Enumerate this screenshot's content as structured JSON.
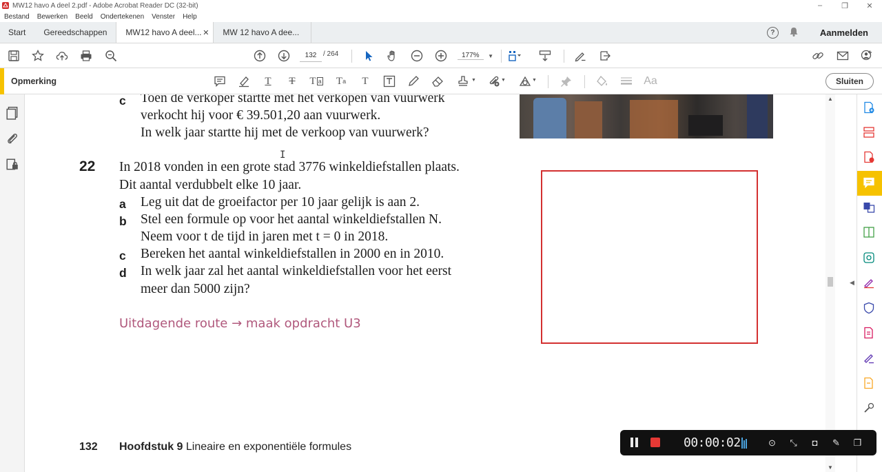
{
  "window": {
    "title": "MW12 havo A deel 2.pdf - Adobe Acrobat Reader DC (32-bit)",
    "controls": [
      "–",
      "❐",
      "✕"
    ]
  },
  "menu": [
    "Bestand",
    "Bewerken",
    "Beeld",
    "Ondertekenen",
    "Venster",
    "Help"
  ],
  "tabs": {
    "home": "Start",
    "tools": "Gereedschappen",
    "active_doc": "MW12 havo A deel...",
    "close": "✕",
    "other_doc": "MW 12 havo A dee..."
  },
  "header_right": {
    "help": "?",
    "signin": "Aanmelden"
  },
  "toolbar": {
    "page_current": "132",
    "page_total": "/ 264",
    "zoom": "177%"
  },
  "comment_bar": {
    "label": "Opmerking",
    "close_label": "Sluiten",
    "text_tools": [
      "T",
      "T",
      "T",
      "T",
      "T",
      "Aa"
    ]
  },
  "document": {
    "prev_question": {
      "letter": "c",
      "lines": [
        "Toen de verkoper startte met het verkopen van vuurwerk",
        "verkocht hij voor € 39.501,20 aan vuurwerk.",
        "In welk jaar startte hij met de verkoop van vuurwerk?"
      ]
    },
    "question": {
      "number": "22",
      "intro": [
        "In 2018 vonden in een grote stad 3776 winkeldiefstallen plaats.",
        "Dit aantal verdubbelt elke 10 jaar."
      ],
      "parts": [
        {
          "letter": "a",
          "lines": [
            "Leg uit dat de groeifactor per 10 jaar gelijk is aan 2."
          ]
        },
        {
          "letter": "b",
          "lines": [
            "Stel een formule op voor het aantal winkeldiefstallen N.",
            "Neem voor t de tijd in jaren met t = 0 in 2018."
          ]
        },
        {
          "letter": "c",
          "lines": [
            "Bereken het aantal winkeldiefstallen in 2000 en in 2010."
          ]
        },
        {
          "letter": "d",
          "lines": [
            "In welk jaar zal het aantal winkeldiefstallen voor het eerst",
            "meer dan 5000 zijn?"
          ]
        }
      ]
    },
    "route": "Uitdagende route → maak opdracht U3",
    "footer": {
      "page": "132",
      "chapter_bold": "Hoofdstuk 9",
      "chapter_title": "Lineaire en exponentiële formules"
    }
  },
  "recorder": {
    "time": "00:00:02"
  },
  "colors": {
    "accent": "#f6c200",
    "route": "#b0587c",
    "annotation_box": "#d32f2f",
    "recorder_stop": "#e53935"
  }
}
